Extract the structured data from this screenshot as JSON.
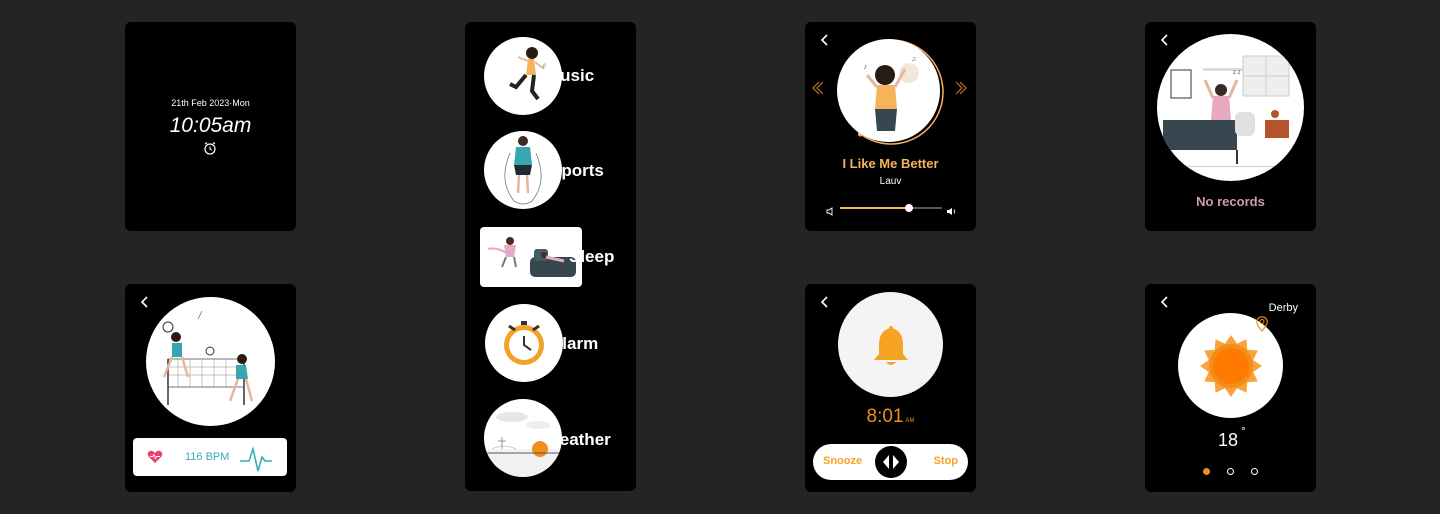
{
  "clock": {
    "date": "21th Feb 2023·Mon",
    "time": "10:05am",
    "icon": "alarm-clock-icon"
  },
  "menu": {
    "items": [
      {
        "label": "Music"
      },
      {
        "label": "Sports"
      },
      {
        "label": "Sleep"
      },
      {
        "label": "Alarm"
      },
      {
        "label": "Weather"
      }
    ]
  },
  "music": {
    "title": "I Like Me Better",
    "artist": "Lauv",
    "volume": 0.68,
    "progress": 0.6,
    "accent": "#f6b35b"
  },
  "sleep": {
    "status": "No records",
    "status_color": "#cc9bb6"
  },
  "heart": {
    "bpm": "116 BPM",
    "accent": "#35aeb6",
    "heart_color": "#e8416b"
  },
  "alarm": {
    "time": "8:01",
    "ampm": "AM",
    "snooze": "Snooze",
    "stop": "Stop",
    "accent": "#f28c1d"
  },
  "weather": {
    "city": "Derby",
    "temp": "18",
    "degree": "°",
    "page": 1,
    "pages": 3,
    "accent": "#f28c1d"
  }
}
